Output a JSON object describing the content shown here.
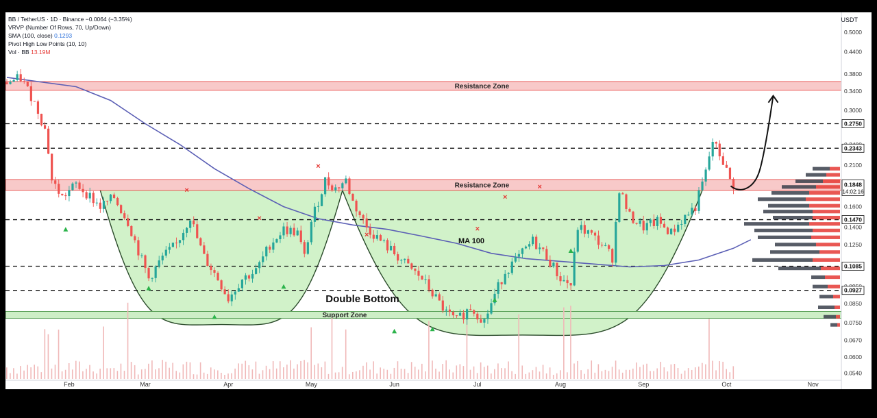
{
  "legend": {
    "line1": "BB / TetherUS · 1D · Binance",
    "line1_change": "−0.0064 (−3.35%)",
    "line2": "VRVP (Number Of Rows, 70, Up/Down)",
    "line3_label": "SMA (100, close)",
    "line3_value": "0.1293",
    "line4": "Pivot High Low Points (10, 10)",
    "line5_label": "Vol · BB",
    "line5_value": "13.19M"
  },
  "currency": "USDT",
  "colors": {
    "up": "#26a69a",
    "down": "#ef5350",
    "ma": "#5b5fb5",
    "zone_fill": "#f8c9c9",
    "zone_border": "#e53935",
    "support_fill": "#cdeec6",
    "bowl_fill": "#c9f0bf",
    "bowl_line": "#2a4a2a",
    "pivot_up": "#2bb34a",
    "pivot_down": "#e53935",
    "volume": "#f0b8b8"
  },
  "chart_data": {
    "type": "candlestick",
    "pair": "BB / TetherUS",
    "timeframe": "1D",
    "exchange": "Binance",
    "y_scale": "log",
    "ylim": [
      0.052,
      0.52
    ],
    "y_ticks": [
      "0.5000",
      "0.4400",
      "0.3800",
      "0.3400",
      "0.3000",
      "0.2400",
      "0.2100",
      "0.1600",
      "0.1400",
      "0.1250",
      "0.0950",
      "0.0850",
      "0.0750",
      "0.0670",
      "0.0600",
      "0.0540"
    ],
    "x_ticks": [
      "Feb",
      "Mar",
      "Apr",
      "May",
      "Jun",
      "Jul",
      "Aug",
      "Sep",
      "Oct",
      "Nov"
    ],
    "last_price": "0.1848",
    "countdown": "14:02:16",
    "levels": [
      "0.2750",
      "0.2343",
      "0.1470",
      "0.1085",
      "0.0927"
    ],
    "level_values": [
      0.275,
      0.2343,
      0.147,
      0.1085,
      0.0927
    ],
    "resistance_top": {
      "label": "Resistance Zone",
      "from": 0.342,
      "to": 0.362
    },
    "resistance_mid": {
      "label": "Resistance Zone",
      "from": 0.178,
      "to": 0.191
    },
    "support": {
      "label": "Support Zone",
      "from": 0.0772,
      "to": 0.0808
    },
    "annotations": {
      "ma_label": "MA 100",
      "pattern": "Double Bottom"
    },
    "price_path": [
      [
        0,
        0.36
      ],
      [
        4,
        0.37
      ],
      [
        7,
        0.33
      ],
      [
        9,
        0.3
      ],
      [
        11,
        0.265
      ],
      [
        12,
        0.23
      ],
      [
        13,
        0.19
      ],
      [
        16,
        0.17
      ],
      [
        20,
        0.185
      ],
      [
        23,
        0.175
      ],
      [
        27,
        0.16
      ],
      [
        31,
        0.17
      ],
      [
        35,
        0.145
      ],
      [
        38,
        0.12
      ],
      [
        41,
        0.1
      ],
      [
        45,
        0.115
      ],
      [
        49,
        0.125
      ],
      [
        53,
        0.15
      ],
      [
        55,
        0.13
      ],
      [
        57,
        0.115
      ],
      [
        61,
        0.1
      ],
      [
        64,
        0.088
      ],
      [
        68,
        0.1
      ],
      [
        72,
        0.105
      ],
      [
        76,
        0.125
      ],
      [
        80,
        0.138
      ],
      [
        84,
        0.135
      ],
      [
        86,
        0.115
      ],
      [
        88,
        0.145
      ],
      [
        92,
        0.19
      ],
      [
        95,
        0.18
      ],
      [
        98,
        0.19
      ],
      [
        100,
        0.165
      ],
      [
        104,
        0.14
      ],
      [
        108,
        0.128
      ],
      [
        112,
        0.118
      ],
      [
        116,
        0.108
      ],
      [
        120,
        0.1
      ],
      [
        124,
        0.088
      ],
      [
        127,
        0.08
      ],
      [
        130,
        0.076
      ],
      [
        134,
        0.083
      ],
      [
        138,
        0.076
      ],
      [
        141,
        0.09
      ],
      [
        144,
        0.105
      ],
      [
        148,
        0.115
      ],
      [
        152,
        0.128
      ],
      [
        156,
        0.116
      ],
      [
        160,
        0.1
      ],
      [
        163,
        0.096
      ],
      [
        165,
        0.14
      ],
      [
        168,
        0.135
      ],
      [
        172,
        0.125
      ],
      [
        175,
        0.115
      ],
      [
        177,
        0.18
      ],
      [
        180,
        0.15
      ],
      [
        184,
        0.14
      ],
      [
        188,
        0.145
      ],
      [
        192,
        0.135
      ],
      [
        196,
        0.15
      ],
      [
        199,
        0.16
      ],
      [
        202,
        0.2
      ],
      [
        204,
        0.245
      ],
      [
        207,
        0.215
      ],
      [
        209,
        0.19
      ],
      [
        210,
        0.1848
      ]
    ],
    "ma100_path": [
      [
        0,
        0.372
      ],
      [
        20,
        0.35
      ],
      [
        30,
        0.32
      ],
      [
        40,
        0.275
      ],
      [
        50,
        0.24
      ],
      [
        60,
        0.205
      ],
      [
        70,
        0.18
      ],
      [
        80,
        0.16
      ],
      [
        90,
        0.148
      ],
      [
        100,
        0.142
      ],
      [
        110,
        0.138
      ],
      [
        120,
        0.132
      ],
      [
        130,
        0.126
      ],
      [
        140,
        0.118
      ],
      [
        150,
        0.114
      ],
      [
        160,
        0.112
      ],
      [
        170,
        0.11
      ],
      [
        180,
        0.108
      ],
      [
        190,
        0.109
      ],
      [
        200,
        0.113
      ],
      [
        210,
        0.122
      ],
      [
        215,
        0.129
      ]
    ],
    "pivot_lows": [
      [
        17,
        0.138
      ],
      [
        41,
        0.094
      ],
      [
        60,
        0.078
      ],
      [
        80,
        0.095
      ],
      [
        112,
        0.071
      ],
      [
        123,
        0.072
      ],
      [
        141,
        0.087
      ],
      [
        163,
        0.12
      ]
    ],
    "pivot_highs": [
      [
        52,
        0.178
      ],
      [
        73,
        0.148
      ],
      [
        90,
        0.208
      ],
      [
        104,
        0.133
      ],
      [
        136,
        0.138
      ],
      [
        144,
        0.17
      ],
      [
        154,
        0.182
      ]
    ]
  },
  "volume_profile": {
    "rows": [
      {
        "p": 0.205,
        "up": 25,
        "dn": 15
      },
      {
        "p": 0.197,
        "up": 30,
        "dn": 20
      },
      {
        "p": 0.189,
        "up": 40,
        "dn": 25
      },
      {
        "p": 0.182,
        "up": 50,
        "dn": 35
      },
      {
        "p": 0.175,
        "up": 55,
        "dn": 45
      },
      {
        "p": 0.168,
        "up": 70,
        "dn": 50
      },
      {
        "p": 0.161,
        "up": 60,
        "dn": 45
      },
      {
        "p": 0.155,
        "up": 72,
        "dn": 40
      },
      {
        "p": 0.149,
        "up": 58,
        "dn": 40
      },
      {
        "p": 0.143,
        "up": 95,
        "dn": 45
      },
      {
        "p": 0.137,
        "up": 85,
        "dn": 40
      },
      {
        "p": 0.131,
        "up": 78,
        "dn": 42
      },
      {
        "p": 0.125,
        "up": 60,
        "dn": 35
      },
      {
        "p": 0.119,
        "up": 72,
        "dn": 30
      },
      {
        "p": 0.113,
        "up": 88,
        "dn": 40
      },
      {
        "p": 0.107,
        "up": 62,
        "dn": 28
      },
      {
        "p": 0.101,
        "up": 20,
        "dn": 22
      },
      {
        "p": 0.095,
        "up": 22,
        "dn": 18
      },
      {
        "p": 0.089,
        "up": 20,
        "dn": 10
      },
      {
        "p": 0.083,
        "up": 24,
        "dn": 8
      },
      {
        "p": 0.078,
        "up": 18,
        "dn": 6
      },
      {
        "p": 0.074,
        "up": 10,
        "dn": 4
      }
    ]
  }
}
